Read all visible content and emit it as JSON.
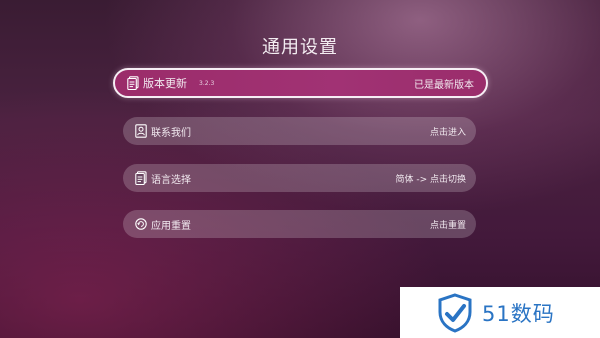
{
  "page": {
    "title": "通用设置"
  },
  "menu": [
    {
      "label": "版本更新",
      "version": "3.2.3",
      "action": "已是最新版本",
      "icon": "document-icon",
      "active": true
    },
    {
      "label": "联系我们",
      "action": "点击进入",
      "icon": "contact-card-icon",
      "active": false
    },
    {
      "label": "语言选择",
      "action": "简体 -> 点击切换",
      "icon": "language-doc-icon",
      "active": false
    },
    {
      "label": "应用重置",
      "action": "点击重置",
      "icon": "reset-icon",
      "active": false
    }
  ],
  "watermark": {
    "text": "51数码",
    "icon": "shield-logo-icon",
    "color": "#2a74c4"
  },
  "colors": {
    "accent": "#9e2f6f",
    "row_bg": "rgba(255,255,255,0.20)"
  }
}
